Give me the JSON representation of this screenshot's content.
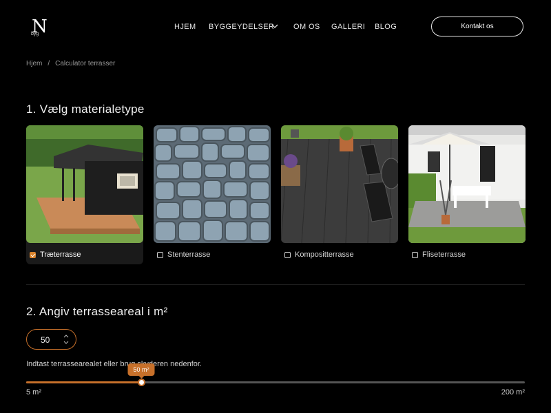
{
  "header": {
    "logo_letter": "N",
    "logo_sub": "byg",
    "nav": [
      {
        "label": "HJEM"
      },
      {
        "label": "BYGGEYDELSER"
      },
      {
        "label": "OM OS"
      },
      {
        "label": "GALLERI"
      },
      {
        "label": "BLOG"
      }
    ],
    "contact_label": "Kontakt os"
  },
  "breadcrumb": {
    "home": "Hjem",
    "separator": "/",
    "current": "Calculator terrasser"
  },
  "section1": {
    "title": "1. Vælg materialetype",
    "options": [
      {
        "label": "Træterrasse",
        "checked": true,
        "icon": "wood-cabin-image"
      },
      {
        "label": "Stenterrasse",
        "checked": false,
        "icon": "stone-paving-image"
      },
      {
        "label": "Kompositterrasse",
        "checked": false,
        "icon": "composite-deck-image"
      },
      {
        "label": "Fliseterrasse",
        "checked": false,
        "icon": "tile-patio-image"
      }
    ]
  },
  "section2": {
    "title": "2. Angiv terrasseareal i m²",
    "area_value": "50",
    "helper": "Indtast terrassearealet eller brug skyderen nedenfor.",
    "slider": {
      "min": 5,
      "max": 200,
      "value": 50,
      "min_label": "5 m²",
      "max_label": "200 m²",
      "tooltip": "50 m²"
    }
  },
  "colors": {
    "accent": "#c7702a",
    "background": "#000000"
  }
}
